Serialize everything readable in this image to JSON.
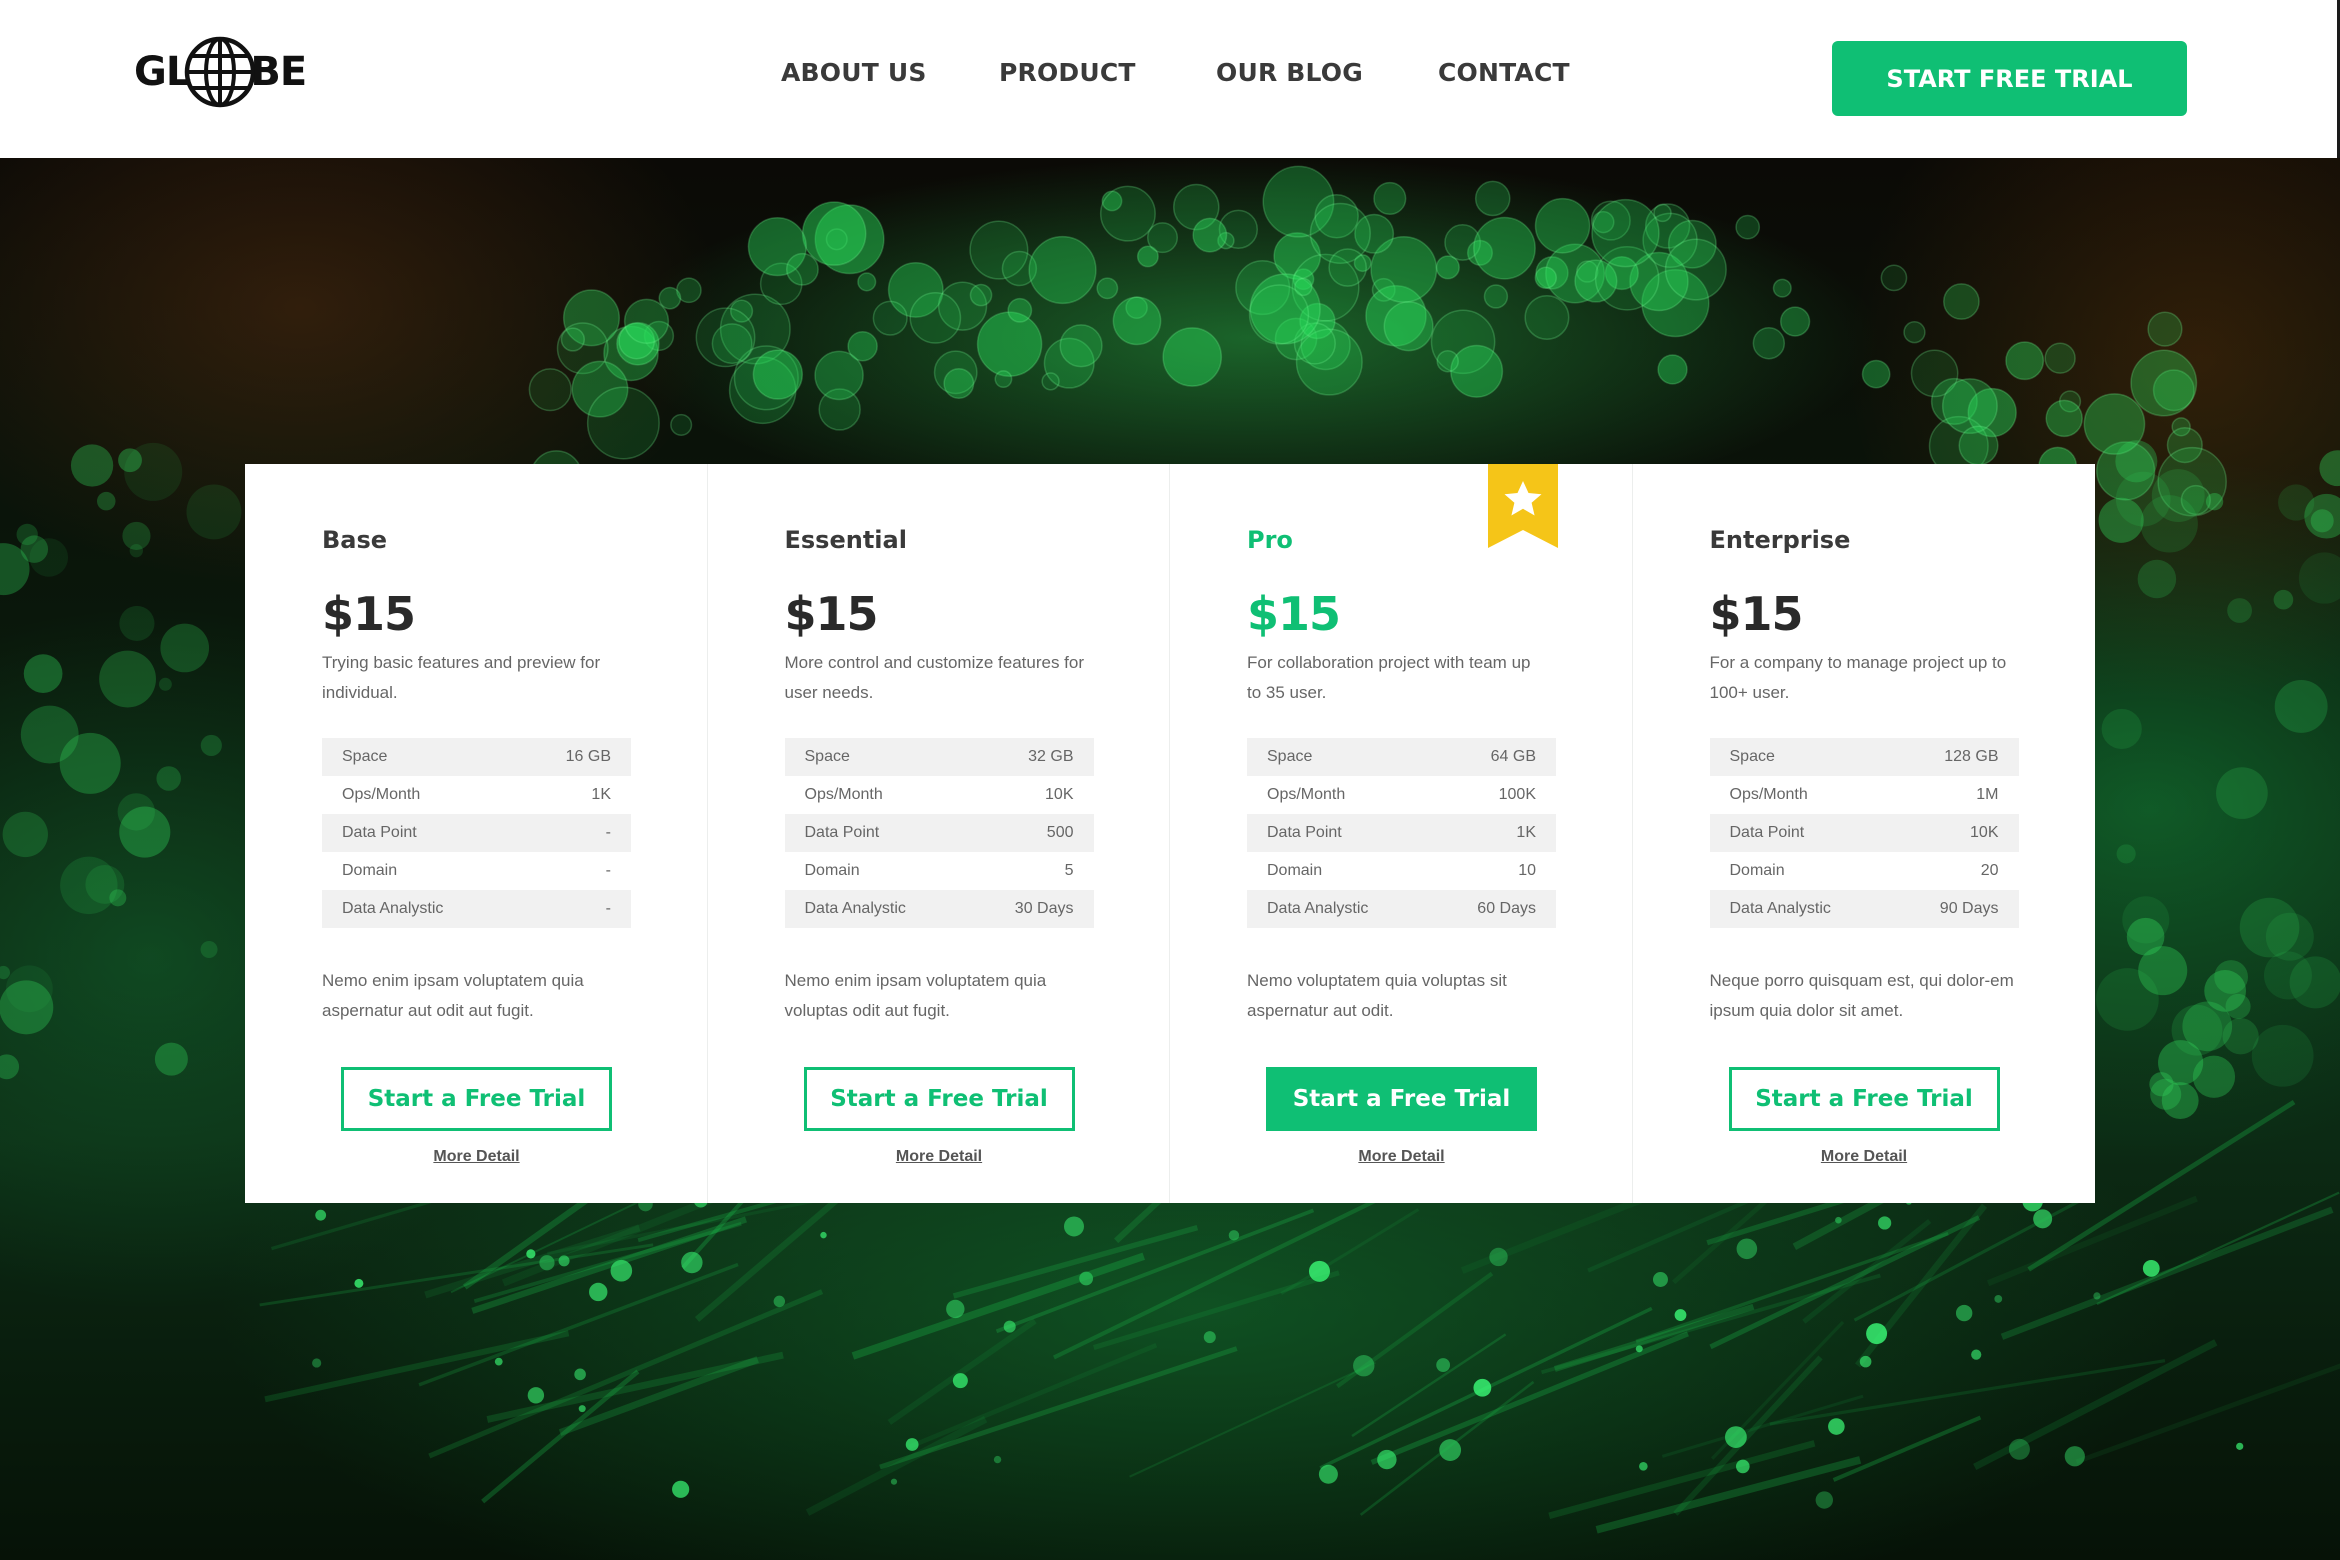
{
  "brand": {
    "logo_left": "GL",
    "logo_right": "BE",
    "logo_icon": "globe-icon"
  },
  "nav": {
    "items": [
      {
        "label": "ABOUT US"
      },
      {
        "label": "PRODUCT"
      },
      {
        "label": "OUR BLOG"
      },
      {
        "label": "CONTACT"
      }
    ],
    "cta_label": "START FREE TRIAL"
  },
  "colors": {
    "accent": "#0fbf74",
    "ribbon": "#f5c518",
    "text_dark": "#3a3a3a"
  },
  "plans": [
    {
      "name": "Base",
      "price": "$15",
      "description": "Trying basic features and preview for individual.",
      "features": [
        {
          "label": "Space",
          "value": "16 GB"
        },
        {
          "label": "Ops/Month",
          "value": "1K"
        },
        {
          "label": "Data Point",
          "value": "-"
        },
        {
          "label": "Domain",
          "value": "-"
        },
        {
          "label": "Data Analystic",
          "value": "-"
        }
      ],
      "note": "Nemo enim ipsam voluptatem quia aspernatur aut odit aut fugit.",
      "button_label": "Start a Free Trial",
      "detail_label": "More Detail"
    },
    {
      "name": "Essential",
      "price": "$15",
      "description": "More control and customize features for user needs.",
      "features": [
        {
          "label": "Space",
          "value": "32 GB"
        },
        {
          "label": "Ops/Month",
          "value": "10K"
        },
        {
          "label": "Data Point",
          "value": "500"
        },
        {
          "label": "Domain",
          "value": "5"
        },
        {
          "label": "Data Analystic",
          "value": "30 Days"
        }
      ],
      "note": "Nemo enim ipsam voluptatem quia voluptas odit aut fugit.",
      "button_label": "Start a Free Trial",
      "detail_label": "More Detail"
    },
    {
      "name": "Pro",
      "price": "$15",
      "description": "For collaboration project with team up to 35 user.",
      "features": [
        {
          "label": "Space",
          "value": "64 GB"
        },
        {
          "label": "Ops/Month",
          "value": "100K"
        },
        {
          "label": "Data Point",
          "value": "1K"
        },
        {
          "label": "Domain",
          "value": "10"
        },
        {
          "label": "Data Analystic",
          "value": "60 Days"
        }
      ],
      "note": "Nemo voluptatem quia voluptas sit aspernatur aut odit.",
      "button_label": "Start a Free Trial",
      "detail_label": "More Detail",
      "featured": true,
      "badge_icon": "star-icon"
    },
    {
      "name": "Enterprise",
      "price": "$15",
      "description": "For a company to manage project up to 100+ user.",
      "features": [
        {
          "label": "Space",
          "value": "128 GB"
        },
        {
          "label": "Ops/Month",
          "value": "1M"
        },
        {
          "label": "Data Point",
          "value": "10K"
        },
        {
          "label": "Domain",
          "value": "20"
        },
        {
          "label": "Data Analystic",
          "value": "90 Days"
        }
      ],
      "note": "Neque porro quisquam est, qui dolor-em ipsum quia dolor sit amet.",
      "button_label": "Start a Free Trial",
      "detail_label": "More Detail"
    }
  ]
}
